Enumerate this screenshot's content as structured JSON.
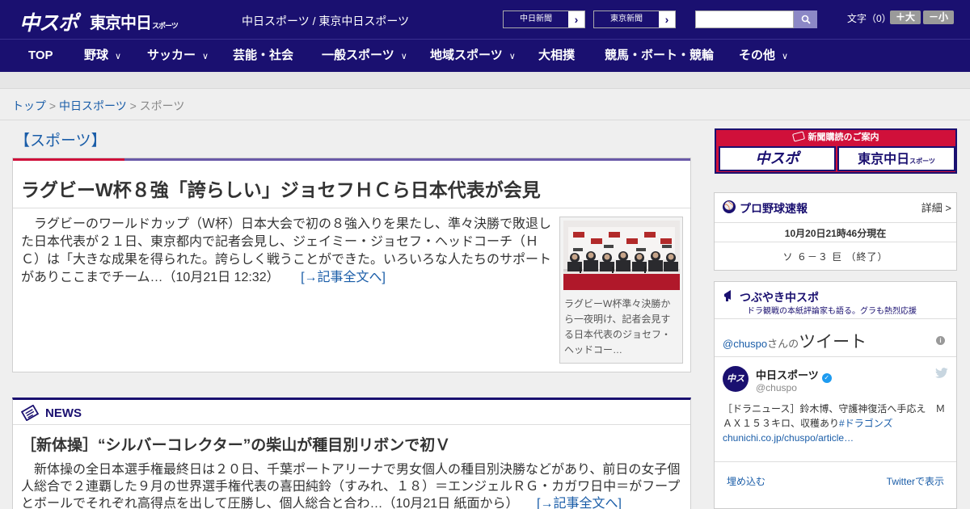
{
  "header": {
    "logo_primary": "中スポ",
    "logo_secondary": "東京中日",
    "logo_secondary_small": "スポーツ",
    "site_title": "中日スポーツ / 東京中日スポーツ",
    "paper_links": [
      {
        "label": "中日新聞"
      },
      {
        "label": "東京新聞"
      }
    ],
    "search_placeholder": "",
    "font_size_label": "文字（0）",
    "font_larger": "＋大",
    "font_smaller": "－小"
  },
  "nav": {
    "items": [
      {
        "label": "TOP"
      },
      {
        "label": "野球"
      },
      {
        "label": "サッカー"
      },
      {
        "label": "芸能・社会"
      },
      {
        "label": "一般スポーツ"
      },
      {
        "label": "地域スポーツ"
      },
      {
        "label": "大相撲"
      },
      {
        "label": "競馬・ボート・競輪"
      },
      {
        "label": "その他"
      }
    ]
  },
  "breadcrumb": {
    "home": "トップ",
    "sep": ">",
    "parent": "中日スポーツ",
    "current": "スポーツ"
  },
  "section_title": "【スポーツ】",
  "main_article": {
    "headline": "ラグビーW杯８強「誇らしい」ジョセフＨＣら日本代表が会見",
    "lede": "　ラグビーのワールドカップ（Ｗ杯）日本大会で初の８強入りを果たし、準々決勝で敗退した日本代表が２１日、東京都内で記者会見し、ジェイミー・ジョセフ・ヘッドコーチ（ＨＣ）は「大きな成果を得られた。誇らしく戦うことができた。いろいろな人たちのサポートがありここまでチーム…（10月21日 12:32）",
    "more_link": "[→記事全文へ]",
    "photo_caption": "ラグビーW杯準々決勝から一夜明け、記者会見する日本代表のジョセフ・ヘッドコー…"
  },
  "news": {
    "heading": "NEWS",
    "title": "［新体操］“シルバーコレクター”の柴山が種目別リボンで初Ｖ",
    "body": "　新体操の全日本選手権最終日は２０日、千葉ポートアリーナで男女個人の種目別決勝などがあり、前日の女子個人総合で２連覇した９月の世界選手権代表の喜田純鈴（すみれ、１８）＝エンジェルＲＧ・カガワ日中＝がフープとボールでそれぞれ高得点を出して圧勝し、個人総合と合わ…（10月21日 紙面から）",
    "more_link": "[→記事全文へ]"
  },
  "sidebar": {
    "subscribe": {
      "title": "新聞購読のご案内",
      "logo_left": "中スポ",
      "logo_right": "東京中日",
      "logo_right_small": "スポーツ"
    },
    "baseball": {
      "title": "プロ野球速報",
      "detail_link": "詳細 >",
      "timestamp": "10月20日21時46分現在",
      "score": "ソ ６－３ 巨 （終了）"
    },
    "tweets": {
      "title": "つぶやき中スポ",
      "subtitle": "ドラ観戦の本紙評論家も語る。グラも熱烈応援",
      "handle": "@chuspo",
      "handle_suffix": "さんの",
      "tweets_label": "ツイート",
      "account_name": "中日スポーツ",
      "account_handle": "@chuspo",
      "tweet_text": "［ドラニュース］鈴木博、守護神復活へ手応え　ＭＡＸ１５３キロ、収穫あり",
      "tweet_hashtag": "#ドラゴンズ",
      "tweet_url": "chunichi.co.jp/chuspo/article…",
      "embed_link": "埋め込む",
      "view_on_twitter": "Twitterで表示"
    }
  },
  "colors": {
    "brand_navy": "#1a1070",
    "accent_red": "#d0103a",
    "link_blue": "#1a5da8"
  }
}
